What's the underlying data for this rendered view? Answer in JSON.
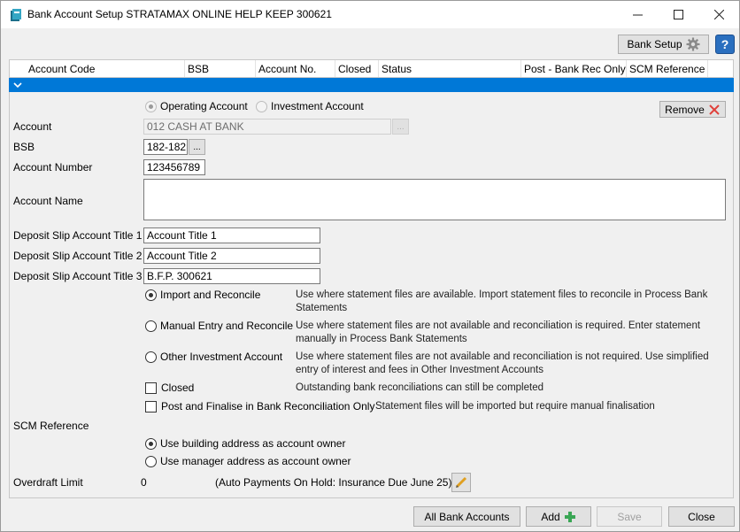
{
  "window": {
    "title": "Bank Account Setup STRATAMAX ONLINE HELP KEEP 300621",
    "minimize": "—",
    "maximize": "☐",
    "close": "✕"
  },
  "toolbar": {
    "bank_setup_label": "Bank Setup",
    "help_label": "?"
  },
  "grid": {
    "columns": [
      "Account Code",
      "BSB",
      "Account No.",
      "Closed",
      "Status",
      "Post - Bank Rec Only",
      "SCM Reference"
    ]
  },
  "form": {
    "account_type_options": [
      "Operating Account",
      "Investment Account"
    ],
    "account_type_selected": "Operating Account",
    "remove_label": "Remove",
    "account": {
      "label": "Account",
      "value": "012 CASH AT BANK",
      "browse": "..."
    },
    "bsb": {
      "label": "BSB",
      "value": "182-182",
      "browse": "..."
    },
    "account_number": {
      "label": "Account Number",
      "value": "123456789"
    },
    "account_name": {
      "label": "Account Name",
      "value": ""
    },
    "deposit_titles": [
      {
        "label": "Deposit Slip Account Title 1",
        "value": "Account Title 1"
      },
      {
        "label": "Deposit Slip Account Title 2",
        "value": "Account Title 2"
      },
      {
        "label": "Deposit Slip Account Title 3",
        "value": "B.F.P. 300621"
      }
    ],
    "methods": [
      {
        "label": "Import and Reconcile",
        "checked": true,
        "desc1": "Use where statement files are available.  Import statement files to reconcile in Process Bank",
        "desc2": "Statements"
      },
      {
        "label": "Manual Entry and Reconcile",
        "checked": false,
        "desc1": "Use where statement files are not available and reconciliation is required.  Enter statement",
        "desc2": "manually in Process Bank Statements"
      },
      {
        "label": "Other Investment Account",
        "checked": false,
        "desc1": "Use where statement files are not available and reconciliation is not required.  Use simplified",
        "desc2": "entry of interest and fees in Other Investment Accounts"
      }
    ],
    "closed": {
      "label": "Closed",
      "checked": false,
      "desc": "Outstanding bank reconciliations can still be completed"
    },
    "post_finalise": {
      "label": "Post and Finalise in Bank Reconciliation Only",
      "checked": false,
      "desc": "Statement files will be imported but require manual finalisation"
    },
    "scm_reference": {
      "label": "SCM Reference",
      "options": [
        "Use building address as account owner",
        "Use manager address as account owner"
      ],
      "selected": "Use building address as account owner"
    },
    "overdraft": {
      "label": "Overdraft Limit",
      "value": "0",
      "note": "(Auto Payments On Hold: Insurance Due June 25)"
    }
  },
  "footer": {
    "all_bank_accounts": "All Bank Accounts",
    "add": "Add",
    "save": "Save",
    "close": "Close"
  },
  "colors": {
    "selection_bar": "#0078d7",
    "remove_icon": "#e0403a",
    "add_icon": "#3aa655",
    "edit_icon": "#e0a020"
  }
}
